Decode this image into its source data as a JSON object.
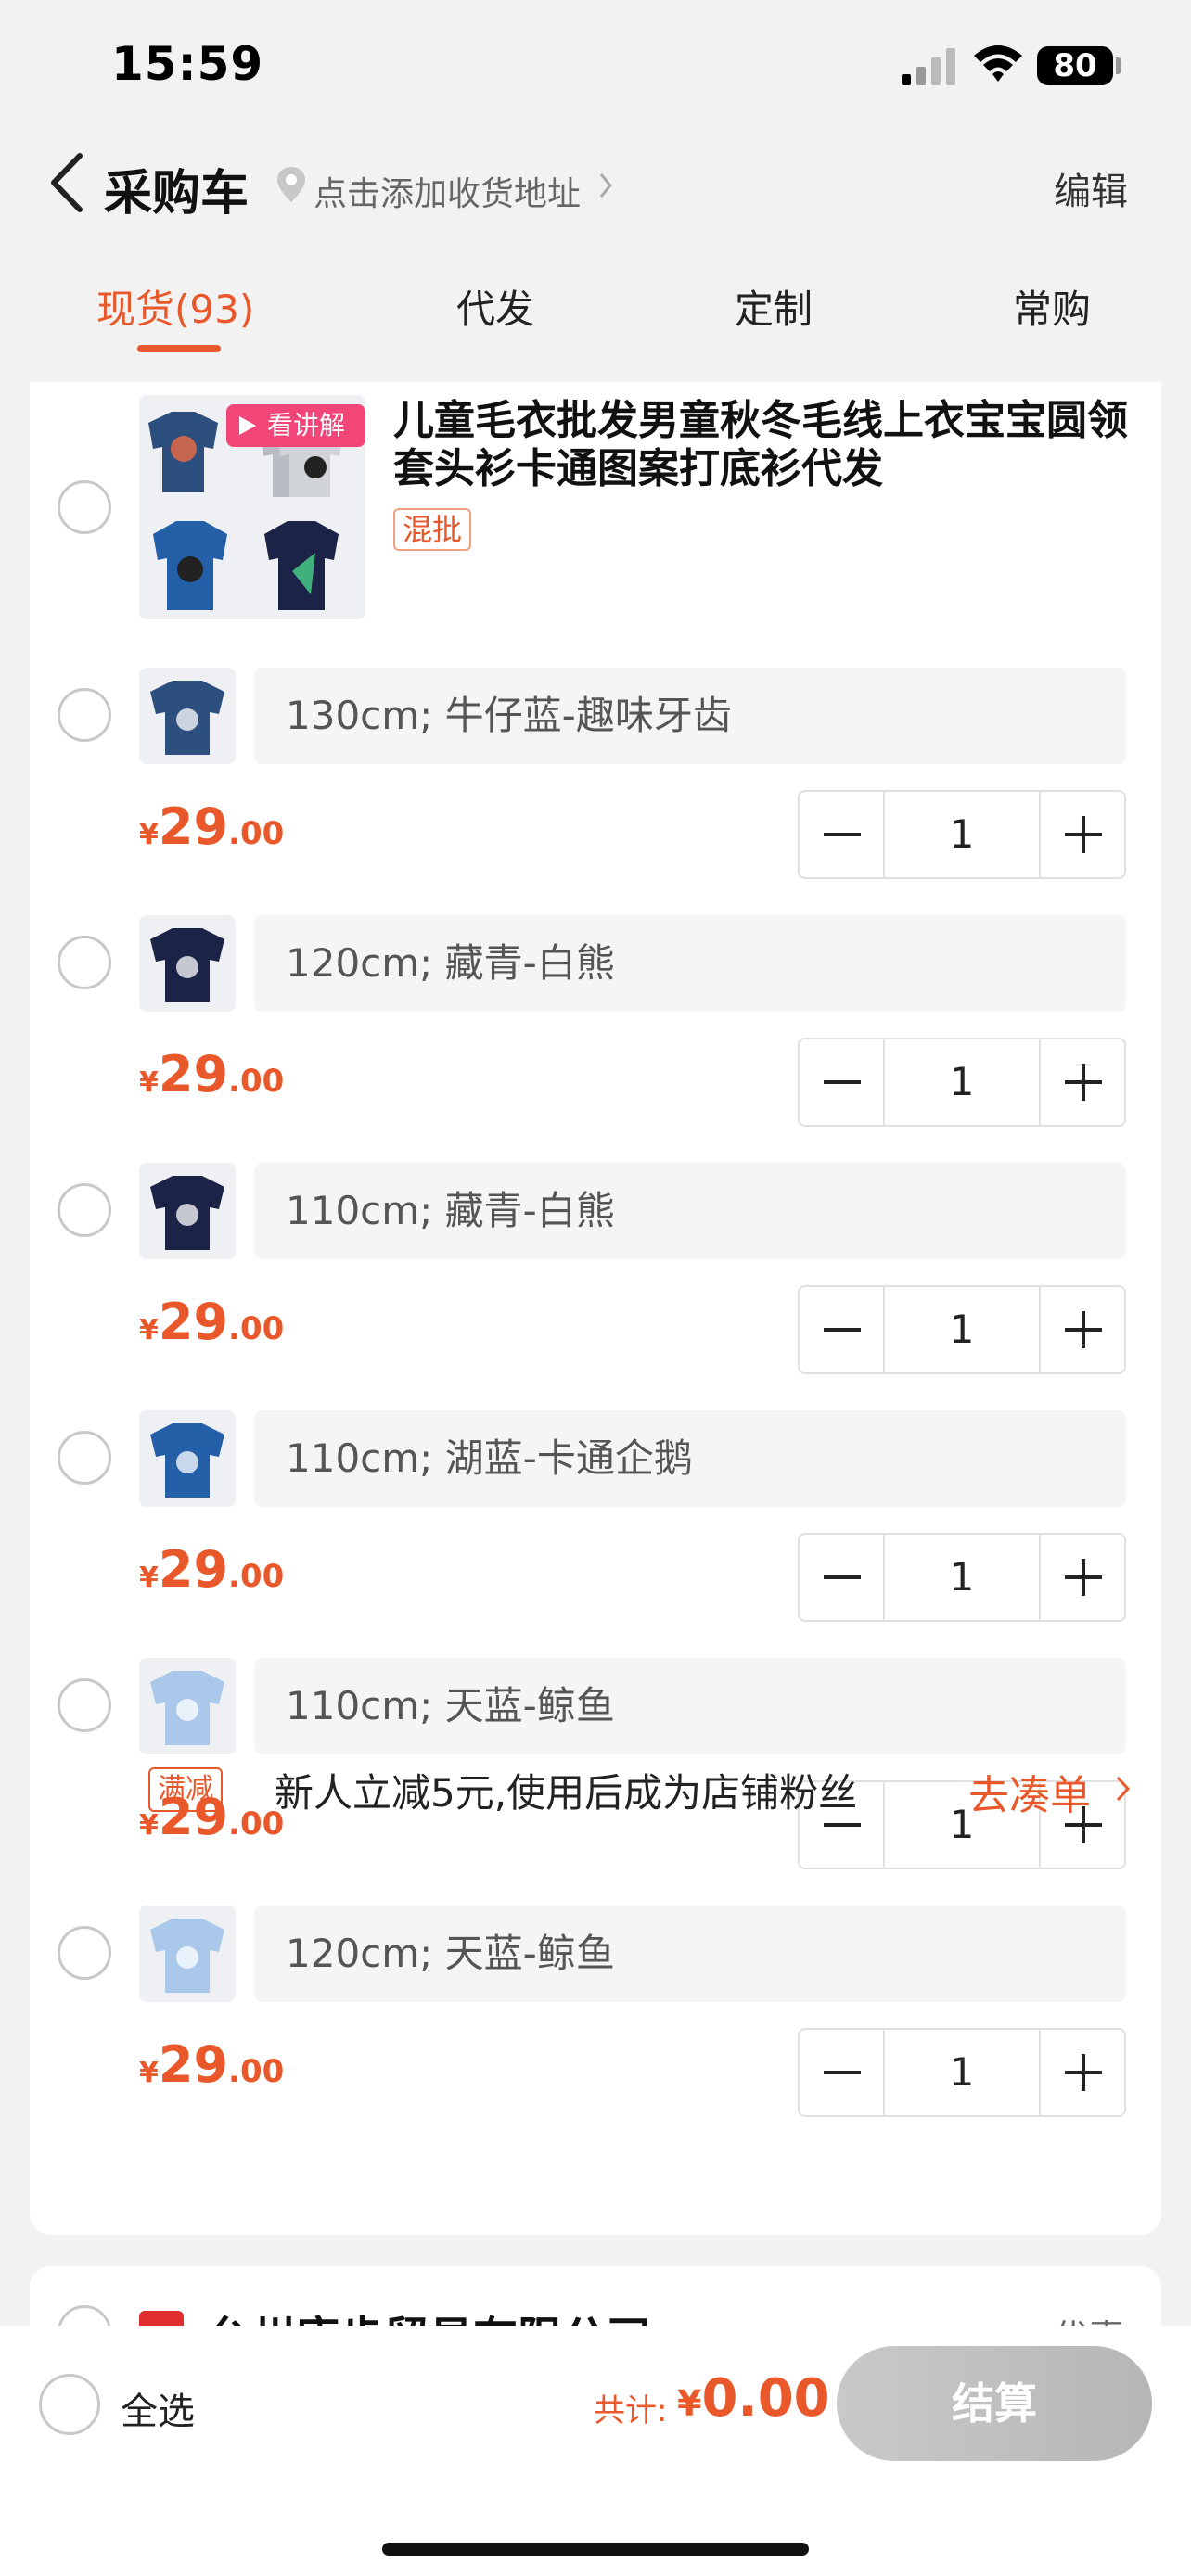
{
  "status_bar": {
    "time": "15:59",
    "battery": "80"
  },
  "nav": {
    "title": "采购车",
    "address_hint": "点击添加收货地址",
    "edit_label": "编辑"
  },
  "tabs": [
    {
      "label": "现货(93)",
      "active": true
    },
    {
      "label": "代发",
      "active": false
    },
    {
      "label": "定制",
      "active": false
    },
    {
      "label": "常购",
      "active": false
    }
  ],
  "product": {
    "title": "儿童毛衣批发男童秋冬毛线上衣宝宝圆领套头衫卡通图案打底衫代发",
    "tag": "混批",
    "video_badge": "看讲解",
    "skus": [
      {
        "spec": "130cm; 牛仔蓝-趣味牙齿",
        "price_currency": "¥",
        "price_int": "29",
        "price_dec": ".00",
        "qty": "1",
        "thumb_color": "#2d4f7e"
      },
      {
        "spec": "120cm; 藏青-白熊",
        "price_currency": "¥",
        "price_int": "29",
        "price_dec": ".00",
        "qty": "1",
        "thumb_color": "#1b2347"
      },
      {
        "spec": "110cm; 藏青-白熊",
        "price_currency": "¥",
        "price_int": "29",
        "price_dec": ".00",
        "qty": "1",
        "thumb_color": "#1b2347"
      },
      {
        "spec": "110cm; 湖蓝-卡通企鹅",
        "price_currency": "¥",
        "price_int": "29",
        "price_dec": ".00",
        "qty": "1",
        "thumb_color": "#2460a8"
      },
      {
        "spec": "110cm; 天蓝-鲸鱼",
        "price_currency": "¥",
        "price_int": "29",
        "price_dec": ".00",
        "qty": "1",
        "thumb_color": "#a9c8ea"
      },
      {
        "spec": "120cm; 天蓝-鲸鱼",
        "price_currency": "¥",
        "price_int": "29",
        "price_dec": ".00",
        "qty": "1",
        "thumb_color": "#a9c8ea"
      }
    ],
    "promo": {
      "tag": "满减",
      "text": "新人立减5元,使用后成为店铺粉丝",
      "link": "去凑单"
    }
  },
  "next_shop": {
    "name": "台州康步贸易有限公司",
    "right_text": "优惠"
  },
  "bottom": {
    "select_all": "全选",
    "total_label": "共计:",
    "total_currency": "¥",
    "total_value": "0.00",
    "checkout": "结算"
  },
  "colors": {
    "accent": "#e8582a",
    "badge_pink": "#f24678",
    "checkout_disabled": "#c0c0c0"
  }
}
